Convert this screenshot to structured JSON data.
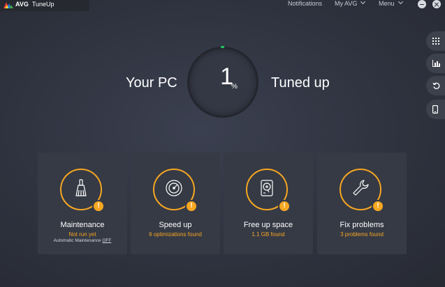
{
  "app": {
    "brand": "AVG",
    "product": "TuneUp"
  },
  "nav": {
    "notifications": "Notifications",
    "my_avg": "My AVG",
    "menu": "Menu"
  },
  "hero": {
    "left": "Your PC",
    "percent": "1",
    "percent_sign": "%",
    "right": "Tuned up",
    "progress": 0.01
  },
  "cards": [
    {
      "title": "Maintenance",
      "status": "Not run yet",
      "extra_prefix": "Automatic Maintenance ",
      "extra_value": "OFF",
      "icon": "broom-icon"
    },
    {
      "title": "Speed up",
      "status": "6 optimizations found",
      "icon": "speedometer-icon"
    },
    {
      "title": "Free up space",
      "status": "1.1 GB found",
      "icon": "hard-drive-icon"
    },
    {
      "title": "Fix problems",
      "status": "3 problems found",
      "icon": "wrench-icon"
    }
  ],
  "alert_mark": "!",
  "side_icons": [
    "grid-icon",
    "bar-chart-icon",
    "undo-icon",
    "mobile-icon"
  ],
  "colors": {
    "accent": "#f7a721",
    "progress": "#22c55e",
    "background": "#2f333f",
    "card": "#363a45"
  }
}
